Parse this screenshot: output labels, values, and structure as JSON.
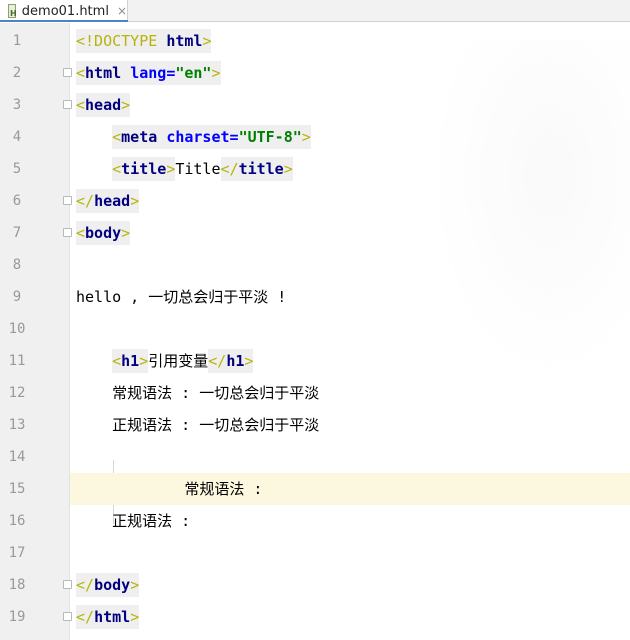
{
  "tab": {
    "filename": "demo01.html",
    "close_glyph": "×",
    "icon": "html-file-icon"
  },
  "lines": [
    {
      "num": "1",
      "parts": [
        [
          "punct",
          "<"
        ],
        [
          "doct",
          "!DOCTYPE "
        ],
        [
          "tname",
          "html"
        ],
        [
          "punct",
          ">"
        ]
      ]
    },
    {
      "num": "2",
      "parts": [
        [
          "punct",
          "<"
        ],
        [
          "tname",
          "html "
        ],
        [
          "attr",
          "lang"
        ],
        [
          "attr",
          "="
        ],
        [
          "aval",
          "\"en\""
        ],
        [
          "punct",
          ">"
        ]
      ]
    },
    {
      "num": "3",
      "parts": [
        [
          "punct",
          "<"
        ],
        [
          "tname",
          "head"
        ],
        [
          "punct",
          ">"
        ]
      ]
    },
    {
      "num": "4",
      "parts": [
        [
          "txt",
          "    "
        ],
        [
          "punct",
          "<"
        ],
        [
          "tname",
          "meta "
        ],
        [
          "attr",
          "charset"
        ],
        [
          "attr",
          "="
        ],
        [
          "aval",
          "\"UTF-8\""
        ],
        [
          "punct",
          ">"
        ]
      ]
    },
    {
      "num": "5",
      "parts": [
        [
          "txt",
          "    "
        ],
        [
          "punct",
          "<"
        ],
        [
          "tname",
          "title"
        ],
        [
          "punct",
          ">"
        ],
        [
          "txt",
          "Title"
        ],
        [
          "punct",
          "</"
        ],
        [
          "tname",
          "title"
        ],
        [
          "punct",
          ">"
        ]
      ]
    },
    {
      "num": "6",
      "parts": [
        [
          "punct",
          "</"
        ],
        [
          "tname",
          "head"
        ],
        [
          "punct",
          ">"
        ]
      ]
    },
    {
      "num": "7",
      "parts": [
        [
          "punct",
          "<"
        ],
        [
          "tname",
          "body"
        ],
        [
          "punct",
          ">"
        ]
      ]
    },
    {
      "num": "8",
      "parts": []
    },
    {
      "num": "9",
      "parts": [
        [
          "txt",
          "hello , "
        ],
        [
          "cjk",
          "一切总会归于平淡"
        ],
        [
          "txt",
          " !"
        ]
      ]
    },
    {
      "num": "10",
      "parts": []
    },
    {
      "num": "11",
      "parts": [
        [
          "txt",
          "    "
        ],
        [
          "punct",
          "<"
        ],
        [
          "tname",
          "h1"
        ],
        [
          "punct",
          ">"
        ],
        [
          "cjk",
          "引用变量"
        ],
        [
          "punct",
          "</"
        ],
        [
          "tname",
          "h1"
        ],
        [
          "punct",
          ">"
        ]
      ]
    },
    {
      "num": "12",
      "parts": [
        [
          "txt",
          "    "
        ],
        [
          "cjk",
          "常规语法"
        ],
        [
          "txt",
          " : "
        ],
        [
          "cjk",
          "一切总会归于平淡"
        ]
      ]
    },
    {
      "num": "13",
      "parts": [
        [
          "txt",
          "    "
        ],
        [
          "cjk",
          "正规语法"
        ],
        [
          "txt",
          " : "
        ],
        [
          "cjk",
          "一切总会归于平淡"
        ]
      ]
    },
    {
      "num": "14",
      "parts": []
    },
    {
      "num": "15",
      "parts": [
        [
          "txt",
          "            "
        ],
        [
          "cjk",
          "常规语法"
        ],
        [
          "txt",
          " :"
        ]
      ]
    },
    {
      "num": "16",
      "parts": [
        [
          "txt",
          "    "
        ],
        [
          "cjk",
          "正规语法"
        ],
        [
          "txt",
          " :"
        ]
      ]
    },
    {
      "num": "17",
      "parts": []
    },
    {
      "num": "18",
      "parts": [
        [
          "punct",
          "</"
        ],
        [
          "tname",
          "body"
        ],
        [
          "punct",
          ">"
        ]
      ]
    },
    {
      "num": "19",
      "parts": [
        [
          "punct",
          "</"
        ],
        [
          "tname",
          "html"
        ],
        [
          "punct",
          ">"
        ]
      ]
    }
  ],
  "current_line": "15",
  "fold_marker_lines": [
    "2",
    "3",
    "6",
    "7",
    "18",
    "19"
  ],
  "colors": {
    "tag_name": "#000080",
    "attribute": "#0000ff",
    "attribute_value": "#008000",
    "bracket": "#b6b40d",
    "current_line_bg": "#fcf8e0",
    "gutter_bg": "#f0f0f0"
  }
}
